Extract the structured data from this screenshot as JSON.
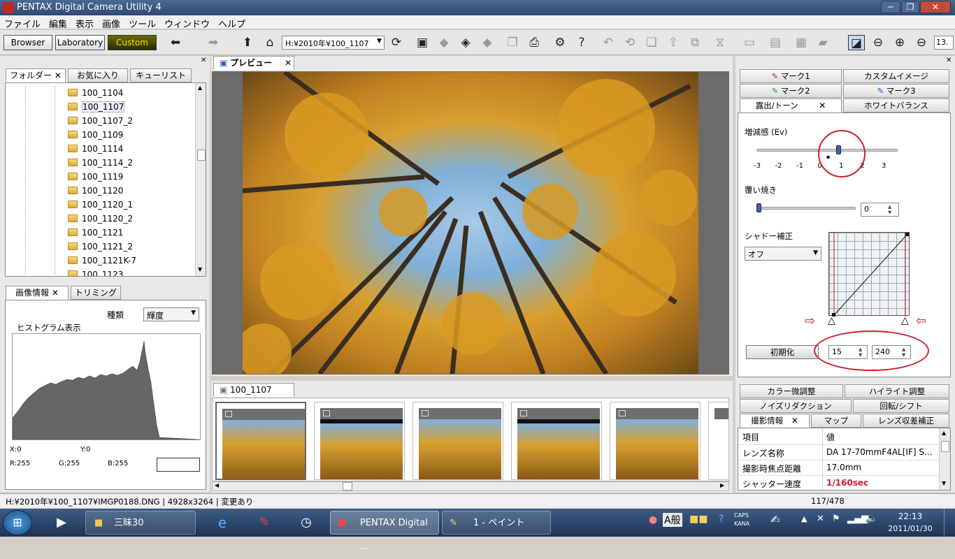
{
  "window": {
    "title": "PENTAX Digital Camera Utility 4",
    "minimize": "─",
    "maximize": "❐",
    "close": "✕"
  },
  "menu": [
    "ファイル",
    "編集",
    "表示",
    "画像",
    "ツール",
    "ウィンドウ",
    "ヘルプ"
  ],
  "modes": {
    "browser": "Browser",
    "laboratory": "Laboratory",
    "custom": "Custom"
  },
  "toolbar": {
    "path": "H:¥2010年¥100_1107",
    "zoom": "13."
  },
  "left_tabs": {
    "folders": "フォルダー",
    "favorites": "お気に入り",
    "queue": "キューリスト"
  },
  "folders": [
    "100_1104",
    "100_1107",
    "100_1107_2",
    "100_1109",
    "100_1114",
    "100_1114_2",
    "100_1119",
    "100_1120",
    "100_1120_1",
    "100_1120_2",
    "100_1121",
    "100_1121_2",
    "100_1121K-7",
    "100_1123"
  ],
  "info_tabs": {
    "image_info": "画像情報",
    "trimming": "トリミング"
  },
  "histogram": {
    "type_label": "種類",
    "type_value": "輝度",
    "title": "ヒストグラム表示",
    "x": "X:0",
    "y": "Y:0",
    "r": "R:255",
    "g": "G:255",
    "b": "B:255"
  },
  "preview": {
    "tab": "プレビュー"
  },
  "filmstrip": {
    "tab": "100_1107"
  },
  "right_tabs": {
    "mark1": "マーク1",
    "custom_image": "カスタムイメージ",
    "mark2": "マーク2",
    "mark3": "マーク3",
    "exposure": "露出/トーン",
    "white_balance": "ホワイトバランス"
  },
  "exposure": {
    "ev_label": "増減感 (Ev)",
    "ev_ticks": [
      "-3",
      "-2",
      "-1",
      "0",
      "1",
      "2",
      "3"
    ],
    "dodge_label": "覆い焼き",
    "dodge_value": "0",
    "shadow_label": "シャドー補正",
    "shadow_value": "オフ",
    "reset": "初期化",
    "low": "15",
    "high": "240"
  },
  "right_bottom_tabs": {
    "color": "カラー微調整",
    "highlight": "ハイライト調整",
    "noise": "ノイズリダクション",
    "rotate": "回転/シフト",
    "shooting": "撮影情報",
    "map": "マップ",
    "lens": "レンズ収差補正"
  },
  "shooting_table": {
    "headers": [
      "項目",
      "値"
    ],
    "rows": [
      [
        "レンズ名称",
        "DA 17-70mmF4AL[IF] S..."
      ],
      [
        "撮影時焦点距離",
        "17.0mm"
      ],
      [
        "シャッター速度",
        "1/160sec"
      ]
    ]
  },
  "status": {
    "path": "H:¥2010年¥100_1107¥IMGP0188.DNG | 4928x3264 | 変更あり",
    "count": "117/478"
  },
  "taskbar": {
    "folder": "三昧30",
    "pentax": "PENTAX Digital ...",
    "paint": "1 - ペイント",
    "ime": "A般",
    "caps": "CAPS",
    "kana": "KANA",
    "time": "22:13",
    "date": "2011/01/30"
  },
  "colors": {
    "accent_red": "#cc1e2a",
    "custom_btn": "#e6d600",
    "photo_sky": "#7fb0d8"
  }
}
